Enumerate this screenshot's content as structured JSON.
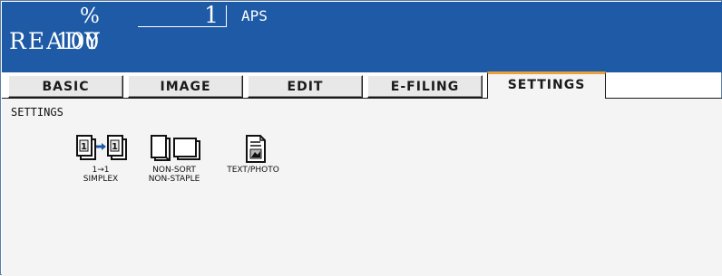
{
  "status_bar": {
    "zoom_value": "100",
    "zoom_unit": "%",
    "copy_count": "1",
    "paper_mode": "APS",
    "machine_status": "READY"
  },
  "tabs": [
    {
      "label": "BASIC",
      "active": false
    },
    {
      "label": "IMAGE",
      "active": false
    },
    {
      "label": "EDIT",
      "active": false
    },
    {
      "label": "E-FILING",
      "active": false
    },
    {
      "label": "SETTINGS",
      "active": true
    }
  ],
  "panel": {
    "title": "SETTINGS",
    "settings": [
      {
        "icon": "duplex-simplex-icon",
        "line1": "1→1",
        "line2": "SIMPLEX"
      },
      {
        "icon": "sort-staple-icon",
        "line1": "NON-SORT",
        "line2": "NON-STAPLE"
      },
      {
        "icon": "text-photo-icon",
        "line1": "TEXT/PHOTO",
        "line2": ""
      }
    ]
  },
  "colors": {
    "header_bg": "#1e5aa5",
    "active_tab_accent": "#e8a23c",
    "panel_bg": "#f4f4f4"
  }
}
